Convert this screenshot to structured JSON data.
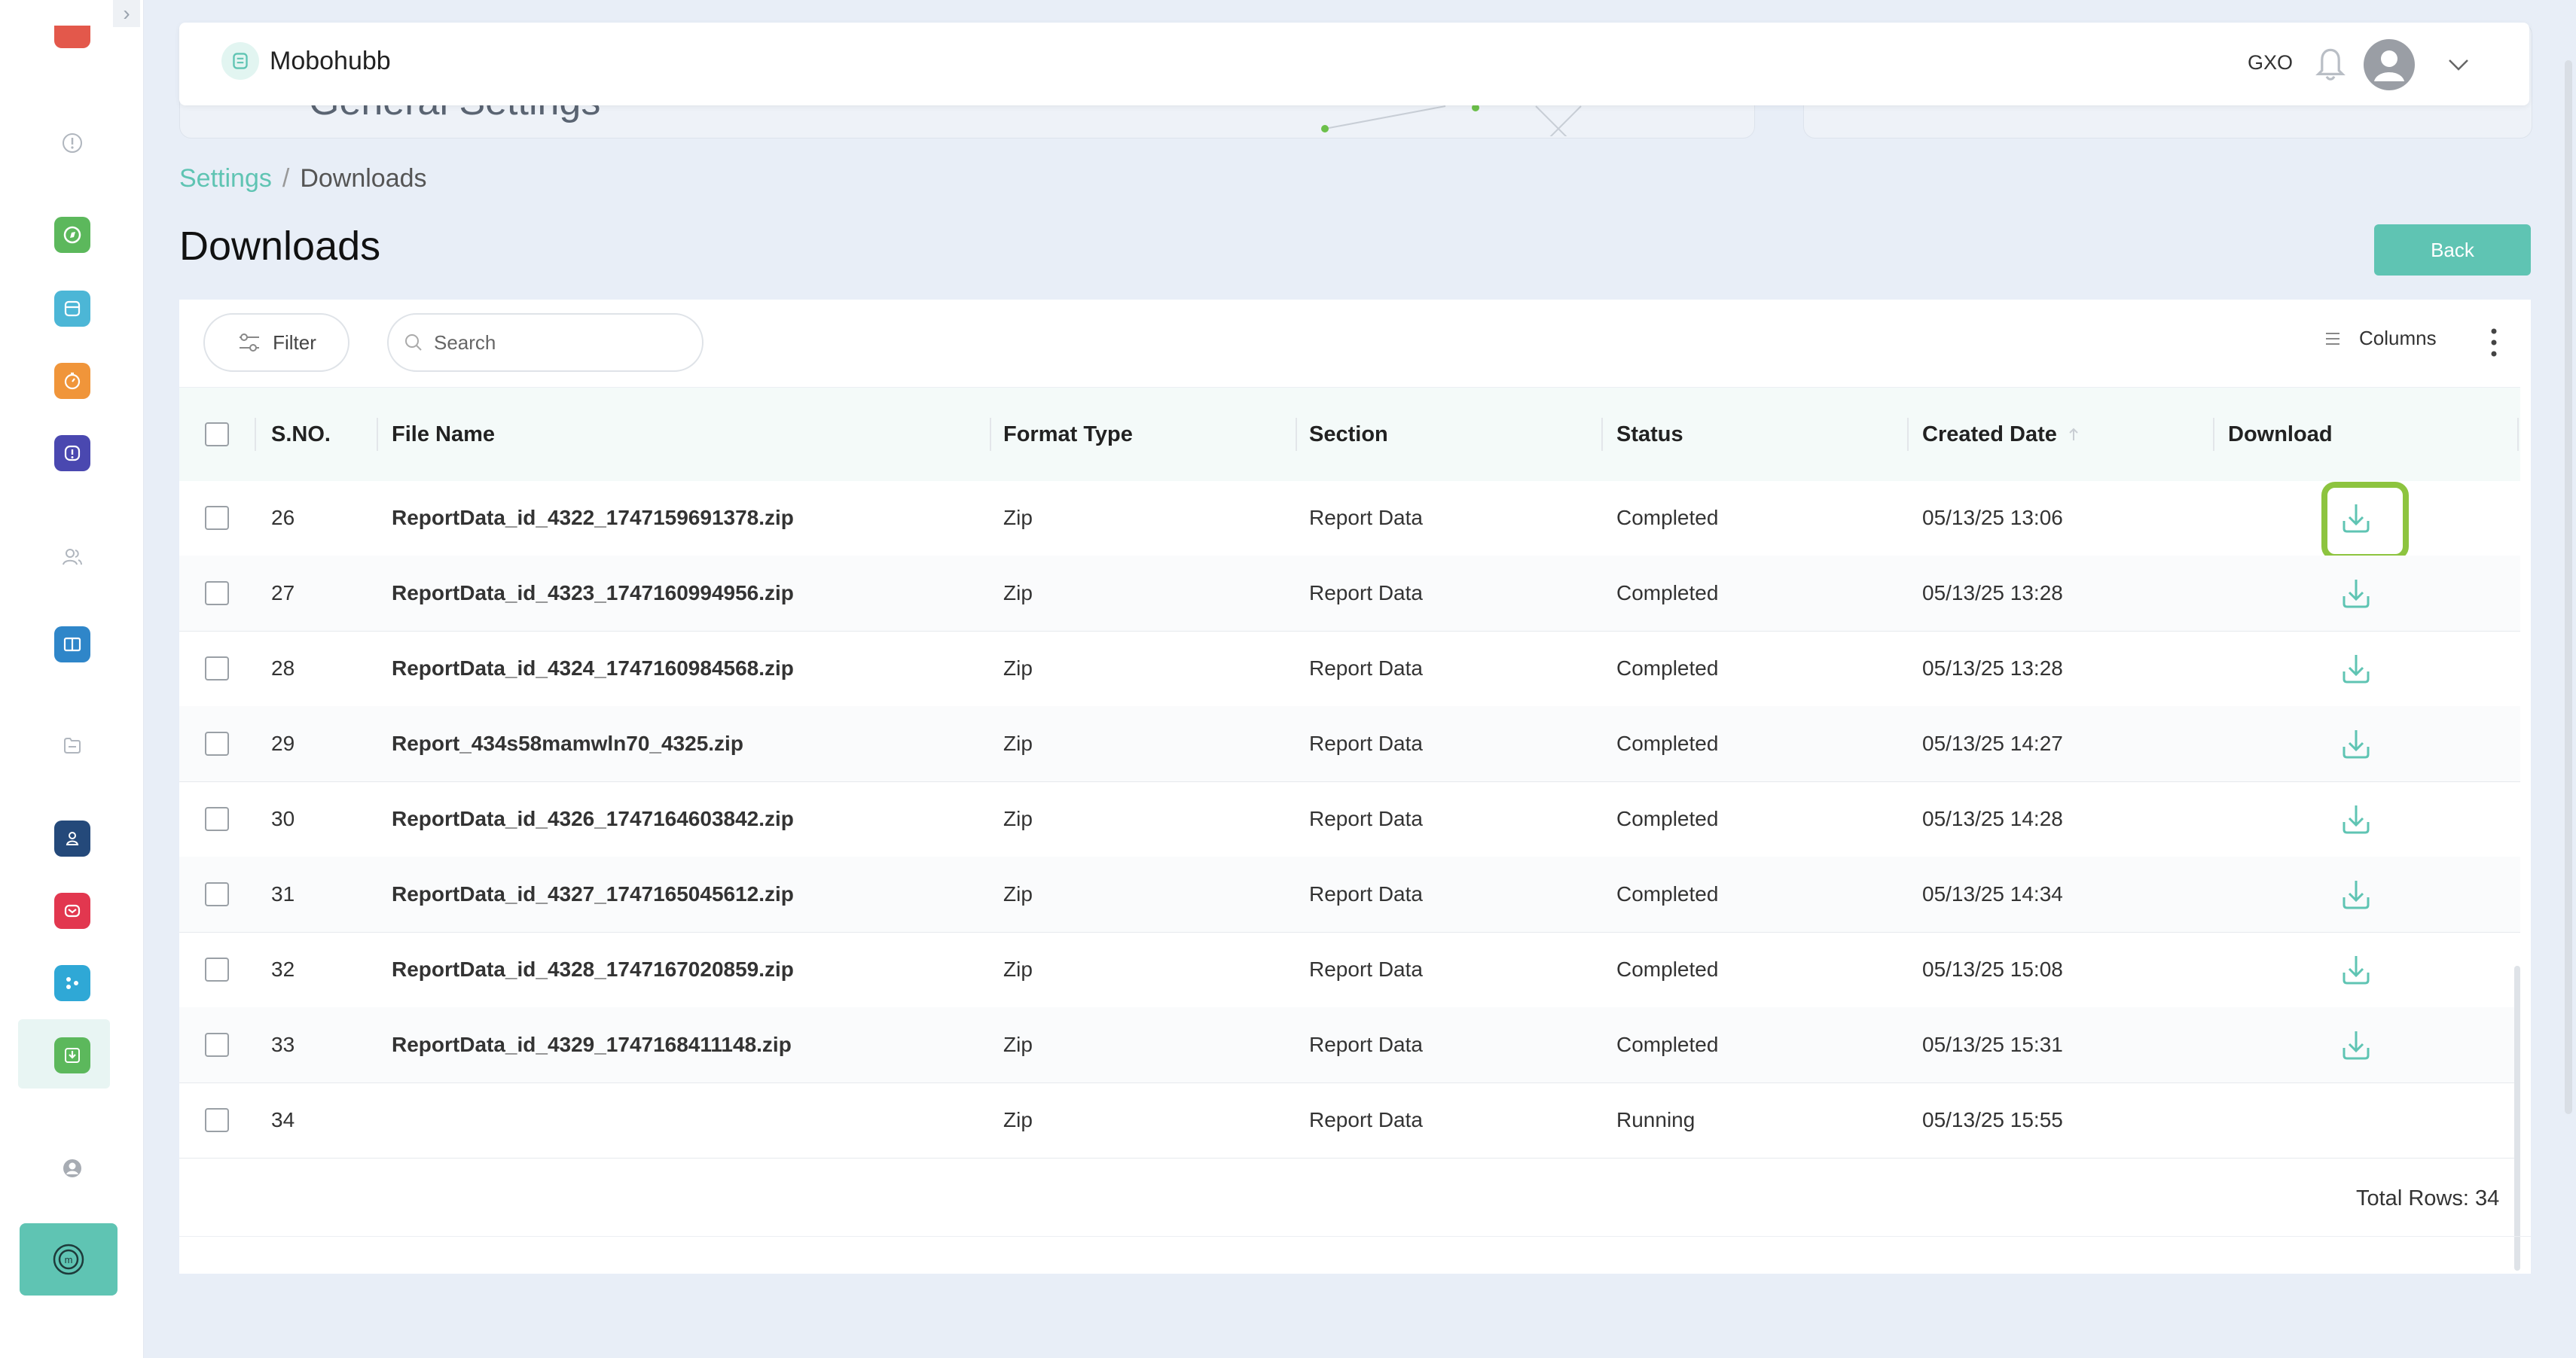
{
  "app": {
    "name": "Mobohubb",
    "org": "GXO"
  },
  "background": {
    "title_partial": "General Settings"
  },
  "breadcrumb": {
    "parent": "Settings",
    "separator": "/",
    "current": "Downloads"
  },
  "page": {
    "title": "Downloads",
    "back_label": "Back"
  },
  "toolbar": {
    "filter_label": "Filter",
    "search_placeholder": "Search",
    "columns_label": "Columns"
  },
  "table": {
    "headers": {
      "sno": "S.NO.",
      "file_name": "File Name",
      "format": "Format Type",
      "section": "Section",
      "status": "Status",
      "created": "Created Date",
      "download": "Download"
    },
    "rows": [
      {
        "sno": "26",
        "file_name": "ReportData_id_4322_1747159691378.zip",
        "format": "Zip",
        "section": "Report Data",
        "status": "Completed",
        "created": "05/13/25 13:06",
        "downloadable": true
      },
      {
        "sno": "27",
        "file_name": "ReportData_id_4323_1747160994956.zip",
        "format": "Zip",
        "section": "Report Data",
        "status": "Completed",
        "created": "05/13/25 13:28",
        "downloadable": true
      },
      {
        "sno": "28",
        "file_name": "ReportData_id_4324_1747160984568.zip",
        "format": "Zip",
        "section": "Report Data",
        "status": "Completed",
        "created": "05/13/25 13:28",
        "downloadable": true
      },
      {
        "sno": "29",
        "file_name": "Report_434s58mamwln70_4325.zip",
        "format": "Zip",
        "section": "Report Data",
        "status": "Completed",
        "created": "05/13/25 14:27",
        "downloadable": true
      },
      {
        "sno": "30",
        "file_name": "ReportData_id_4326_1747164603842.zip",
        "format": "Zip",
        "section": "Report Data",
        "status": "Completed",
        "created": "05/13/25 14:28",
        "downloadable": true
      },
      {
        "sno": "31",
        "file_name": "ReportData_id_4327_1747165045612.zip",
        "format": "Zip",
        "section": "Report Data",
        "status": "Completed",
        "created": "05/13/25 14:34",
        "downloadable": true
      },
      {
        "sno": "32",
        "file_name": "ReportData_id_4328_1747167020859.zip",
        "format": "Zip",
        "section": "Report Data",
        "status": "Completed",
        "created": "05/13/25 15:08",
        "downloadable": true
      },
      {
        "sno": "33",
        "file_name": "ReportData_id_4329_1747168411148.zip",
        "format": "Zip",
        "section": "Report Data",
        "status": "Completed",
        "created": "05/13/25 15:31",
        "downloadable": true
      },
      {
        "sno": "34",
        "file_name": "",
        "format": "Zip",
        "section": "Report Data",
        "status": "Running",
        "created": "05/13/25 15:55",
        "downloadable": false
      }
    ],
    "total_label": "Total Rows: 34"
  },
  "colors": {
    "accent": "#5fc4b3",
    "highlight": "#8dc43f"
  },
  "sidebar": {
    "icons": [
      "camera-icon",
      "alert-icon",
      "compass-icon",
      "tray-icon",
      "stopwatch-icon",
      "alert-badge-icon",
      "users-icon",
      "book-icon",
      "folder-icon",
      "user-badge-icon",
      "mail-icon",
      "dice-icon",
      "download-icon",
      "profile-icon",
      "brand-icon"
    ]
  }
}
